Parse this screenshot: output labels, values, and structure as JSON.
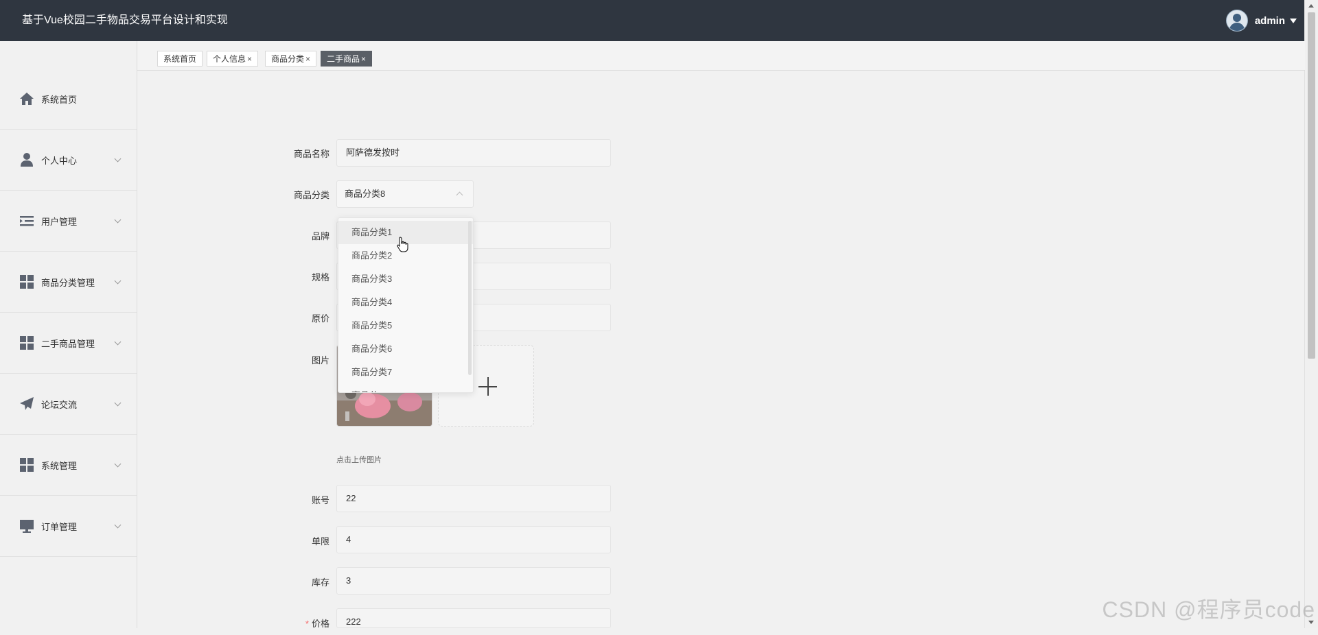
{
  "header": {
    "title": "基于Vue校园二手物品交易平台设计和实现",
    "username": "admin"
  },
  "tabs": [
    {
      "label": "系统首页",
      "closable": false
    },
    {
      "label": "个人信息",
      "closable": true
    },
    {
      "label": "商品分类",
      "closable": true
    },
    {
      "label": "二手商品",
      "closable": true,
      "active": true
    }
  ],
  "tab_close": "×",
  "sidebar": {
    "items": [
      {
        "label": "系统首页",
        "icon": "home-icon"
      },
      {
        "label": "个人中心",
        "icon": "user-icon"
      },
      {
        "label": "用户管理",
        "icon": "list-icon"
      },
      {
        "label": "商品分类管理",
        "icon": "grid-icon"
      },
      {
        "label": "二手商品管理",
        "icon": "grid-icon"
      },
      {
        "label": "论坛交流",
        "icon": "send-icon"
      },
      {
        "label": "系统管理",
        "icon": "grid-icon"
      },
      {
        "label": "订单管理",
        "icon": "monitor-icon"
      }
    ]
  },
  "form": {
    "name": {
      "label": "商品名称",
      "value": "阿萨德发按时"
    },
    "category": {
      "label": "商品分类",
      "value": "商品分类8"
    },
    "brand": {
      "label": "品牌"
    },
    "spec": {
      "label": "规格"
    },
    "original_price": {
      "label": "原价"
    },
    "image": {
      "label": "图片",
      "tip": "点击上传图片"
    },
    "account": {
      "label": "账号",
      "value": "22"
    },
    "limit": {
      "label": "单限",
      "value": "4"
    },
    "stock": {
      "label": "库存",
      "value": "3"
    },
    "price": {
      "label": "价格",
      "value": "222",
      "required_mark": "*"
    }
  },
  "dropdown": {
    "options": [
      "商品分类1",
      "商品分类2",
      "商品分类3",
      "商品分类4",
      "商品分类5",
      "商品分类6",
      "商品分类7"
    ],
    "partial": "商品分",
    "hovered_index": 0
  },
  "watermark": "CSDN @程序员code",
  "colors": {
    "header_bg": "#2f3640",
    "active_tab": "#5a5f66",
    "required": "#f56c6c"
  }
}
